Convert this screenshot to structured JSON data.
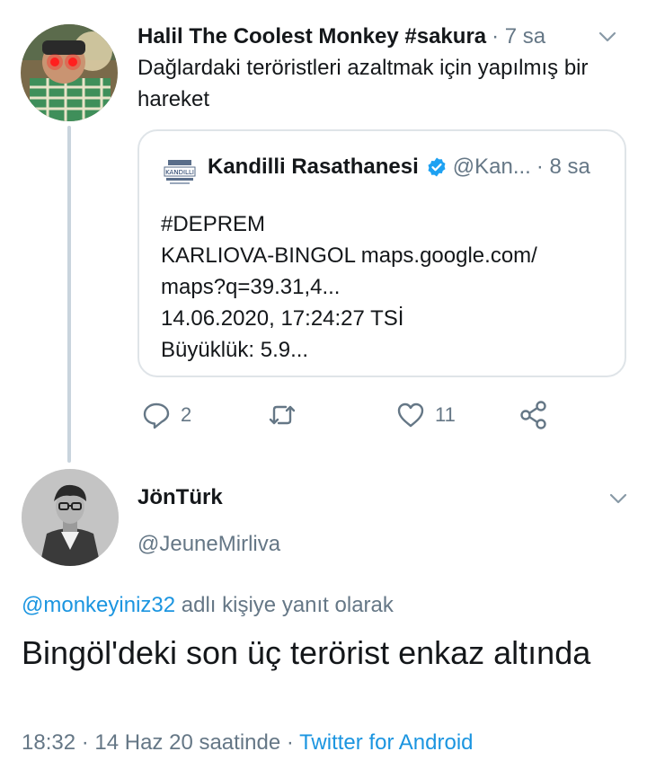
{
  "original_tweet": {
    "author_name": "Halil The Coolest Monkey #sakura",
    "time": "· 7 sa",
    "text": "Dağlardaki teröristleri azaltmak için yapılmış bir hareket",
    "quoted": {
      "author_name": "Kandilli Rasathanesi",
      "handle": "@Kan...",
      "time": "· 8 sa",
      "logo_text": "KANDILLI",
      "lines": [
        "#DEPREM",
        "KARLIOVA-BINGOL maps.google.com/",
        "maps?q=39.31,4...",
        "14.06.2020, 17:24:27 TSİ",
        "Büyüklük: 5.9..."
      ]
    },
    "actions": {
      "reply_count": "2",
      "like_count": "11"
    }
  },
  "reply_tweet": {
    "author_name": "JönTürk",
    "handle": "@JeuneMirliva",
    "reply_mention": "@monkeyiniz32",
    "reply_suffix": " adlı kişiye yanıt olarak",
    "text": "Bingöl'deki son üç terörist enkaz altında",
    "timestamp": "18:32 · 14 Haz 20 saatinde · ",
    "client": "Twitter for Android"
  },
  "colors": {
    "text_primary": "#14171a",
    "text_secondary": "#657786",
    "link": "#1b95e0",
    "verified": "#1da1f2",
    "border": "#dfe4e8"
  }
}
